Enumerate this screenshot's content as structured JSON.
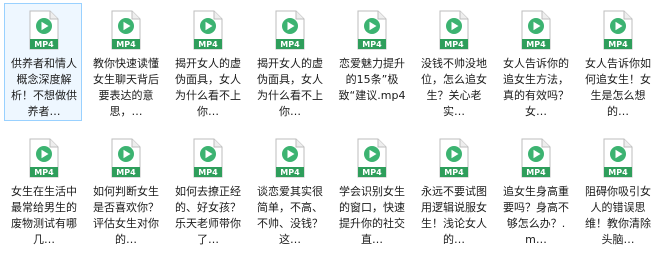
{
  "file_type_badge": "MP4",
  "icon": "mp4-video-file-icon",
  "colors": {
    "icon_green": "#3cb371",
    "badge_green": "#2e9e5b",
    "selection": "#99d1ff"
  },
  "files": [
    {
      "name": "供养者和情人概念深度解析！不想做供养者…",
      "selected": true
    },
    {
      "name": "教你快速读懂女生聊天背后要表达的意思，…",
      "selected": false
    },
    {
      "name": "揭开女人的虚伪面具，女人为什么看不上你…",
      "selected": false
    },
    {
      "name": "揭开女人的虚伪面具，女人为什么看不上你…",
      "selected": false
    },
    {
      "name": "恋爱魅力提升的15条”极致“建议.mp4",
      "selected": false
    },
    {
      "name": "没钱不帅没地位，怎么追女生？关心老实…",
      "selected": false
    },
    {
      "name": "女人告诉你的追女生方法，真的有效吗？女…",
      "selected": false
    },
    {
      "name": "女人告诉你如何追女生！女生是怎么想的…",
      "selected": false
    },
    {
      "name": "女生在生活中最常给男生的废物测试有哪几…",
      "selected": false
    },
    {
      "name": "如何判断女生是否喜欢你？评估女生对你的…",
      "selected": false
    },
    {
      "name": "如何去撩正经的、好女孩？乐天老师带你了…",
      "selected": false
    },
    {
      "name": "谈恋爱其实很简单，不高、不帅、没钱？这…",
      "selected": false
    },
    {
      "name": "学会识别女生的窗口，快速提升你的社交直…",
      "selected": false
    },
    {
      "name": "永远不要试图用逻辑说服女生！浅论女人的…",
      "selected": false
    },
    {
      "name": "追女生身高重要吗？身高不够怎么办？.m…",
      "selected": false
    },
    {
      "name": "阻碍你吸引女人的错误思维！教你清除头脑…",
      "selected": false
    }
  ]
}
